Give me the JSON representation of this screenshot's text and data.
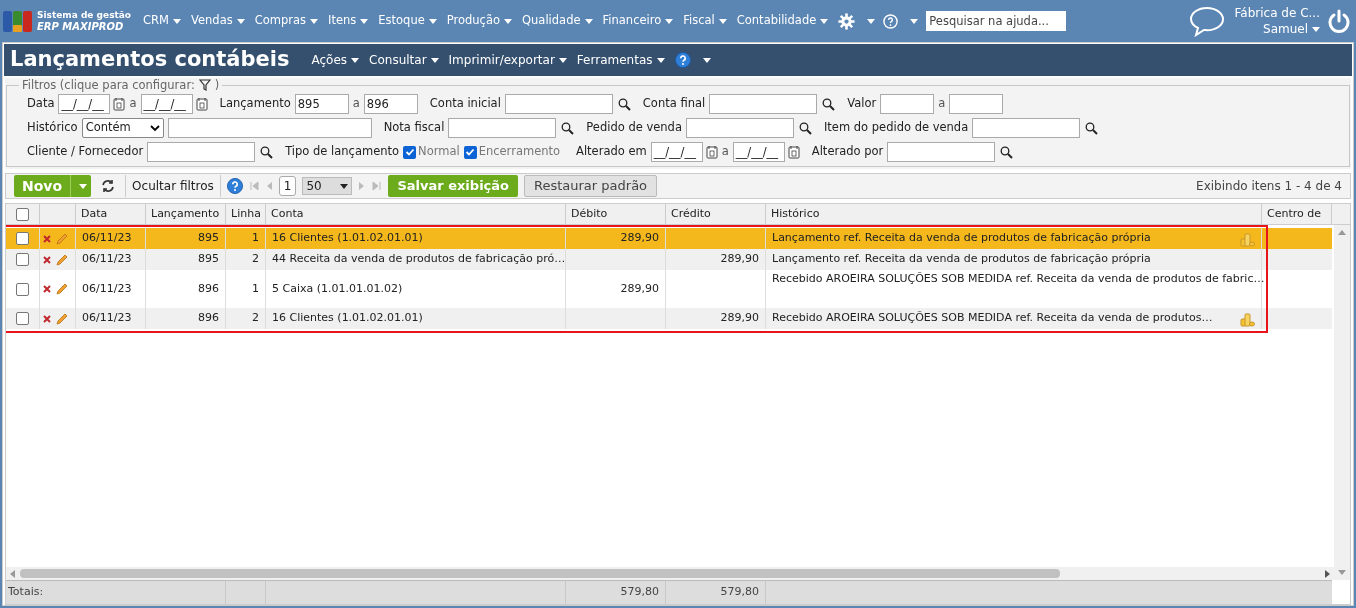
{
  "app": {
    "subtitle": "Sistema de gestão",
    "name": "ERP MAXIPROD"
  },
  "nav": [
    "CRM",
    "Vendas",
    "Compras",
    "Itens",
    "Estoque",
    "Produção",
    "Qualidade",
    "Financeiro",
    "Fiscal",
    "Contabilidade"
  ],
  "help_search": {
    "placeholder": "Pesquisar na ajuda..."
  },
  "user": {
    "company": "Fábrica de C...",
    "name": "Samuel"
  },
  "page": {
    "title": "Lançamentos contábeis",
    "menus": [
      "Ações",
      "Consultar",
      "Imprimir/exportar",
      "Ferramentas"
    ]
  },
  "filters": {
    "legend": "Filtros (clique para configurar:",
    "legend_end": ")",
    "lines": [
      {
        "items": [
          {
            "kind": "label",
            "text": "Data"
          },
          {
            "kind": "date",
            "value": "__/__/__"
          },
          {
            "kind": "sep",
            "text": "a"
          },
          {
            "kind": "date",
            "value": "__/__/__"
          },
          {
            "kind": "label",
            "text": "Lançamento"
          },
          {
            "kind": "number",
            "value": "895"
          },
          {
            "kind": "sep",
            "text": "a"
          },
          {
            "kind": "number",
            "value": "896"
          },
          {
            "kind": "label",
            "text": "Conta inicial"
          },
          {
            "kind": "lookup"
          },
          {
            "kind": "label",
            "text": "Conta final"
          },
          {
            "kind": "lookup"
          },
          {
            "kind": "label",
            "text": "Valor"
          },
          {
            "kind": "number"
          },
          {
            "kind": "sep",
            "text": "a"
          },
          {
            "kind": "number"
          }
        ]
      },
      {
        "items": [
          {
            "kind": "label",
            "text": "Histórico"
          },
          {
            "kind": "select",
            "value": "Contém"
          },
          {
            "kind": "wide"
          },
          {
            "kind": "label",
            "text": "Nota fiscal"
          },
          {
            "kind": "lookup"
          },
          {
            "kind": "label",
            "text": "Pedido de venda"
          },
          {
            "kind": "lookup"
          },
          {
            "kind": "label",
            "text": "Item do pedido de venda"
          },
          {
            "kind": "lookup"
          }
        ]
      },
      {
        "items": [
          {
            "kind": "label",
            "text": "Cliente / Fornecedor"
          },
          {
            "kind": "lookup"
          },
          {
            "kind": "label",
            "text": "Tipo de lançamento"
          },
          {
            "kind": "check",
            "text": "Normal",
            "checked": true
          },
          {
            "kind": "check",
            "text": "Encerramento",
            "checked": true
          },
          {
            "kind": "label",
            "text": "Alterado em"
          },
          {
            "kind": "date",
            "value": "__/__/__"
          },
          {
            "kind": "sep",
            "text": "a"
          },
          {
            "kind": "date",
            "value": "__/__/__"
          },
          {
            "kind": "label",
            "text": "Alterado por"
          },
          {
            "kind": "lookup"
          }
        ]
      }
    ]
  },
  "toolbar": {
    "new": "Novo",
    "hide_filters": "Ocultar filtros",
    "page": "1",
    "page_size": "50",
    "save_view": "Salvar exibição",
    "restore": "Restaurar padrão",
    "count": "Exibindo itens 1 - 4 de 4"
  },
  "table": {
    "all_checked": false,
    "columns": [
      "Data",
      "Lançamento",
      "Linha",
      "Conta",
      "Débito",
      "Crédito",
      "Histórico",
      "Centro de"
    ],
    "rows": [
      {
        "selected": true,
        "checked": false,
        "data": "06/11/23",
        "lancamento": "895",
        "linha": "1",
        "conta": "16 Clientes (1.01.02.01.01)",
        "debito": "289,90",
        "historico": "Lançamento ref. Receita da venda de produtos de fabricação própria",
        "coins": true
      },
      {
        "selected": false,
        "checked": false,
        "data": "06/11/23",
        "lancamento": "895",
        "linha": "2",
        "conta": "44 Receita da venda de produtos de fabricação pró…",
        "credito": "289,90",
        "historico": "Lançamento ref. Receita da venda de produtos de fabricação própria",
        "coins": false
      },
      {
        "selected": false,
        "checked": false,
        "data": "06/11/23",
        "lancamento": "896",
        "linha": "1",
        "conta": "5 Caixa (1.01.01.01.02)",
        "debito": "289,90",
        "historico": "Recebido AROEIRA SOLUÇÕES SOB MEDIDA ref. Receita da venda de produtos de fabric…",
        "coins": false
      },
      {
        "selected": false,
        "checked": false,
        "data": "06/11/23",
        "lancamento": "896",
        "linha": "2",
        "conta": "16 Clientes (1.01.02.01.01)",
        "credito": "289,90",
        "historico": "Recebido AROEIRA SOLUÇÕES SOB MEDIDA ref. Receita da venda de produtos…",
        "coins": true
      }
    ],
    "totals": {
      "label": "Totais:",
      "debito": "579,80",
      "credito": "579,80"
    }
  }
}
